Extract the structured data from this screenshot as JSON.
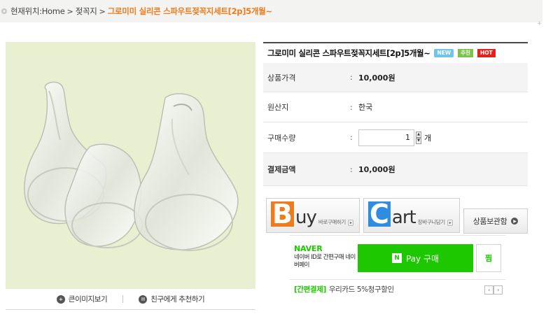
{
  "breadcrumb": {
    "label": "현재위치",
    "colon": " : ",
    "home": "Home",
    "category": "젖꼭지",
    "current": "그로미미 실리콘 스파우트젖꼭지세트[2p]5개월~",
    "separator": ">"
  },
  "image_actions": {
    "zoom_label": "큰이미지보기",
    "recommend_label": "친구에게 추천하기"
  },
  "product": {
    "title": "그로미미 실리콘 스파우트젖꼭지세트[2p]5개월~",
    "badges": {
      "new": "NEW",
      "recommend": "추천",
      "hot": "HOT"
    },
    "colon": ":",
    "price_label": "상품가격",
    "price_value": "10,000원",
    "origin_label": "원산지",
    "origin_value": "한국",
    "qty_label": "구매수량",
    "qty_value": "1",
    "qty_unit": "개",
    "total_label": "결제금액",
    "total_value": "10,000원"
  },
  "buttons": {
    "buy_big": "B",
    "buy_rest": "uy",
    "buy_sub": "바로구매하기",
    "cart_big": "C",
    "cart_rest": "art",
    "cart_sub": "장바구니담기",
    "wish": "상품보관함"
  },
  "naver_pay": {
    "logo": "NAVER",
    "desc": "네이버 ID로 간편구매 네이버페이",
    "pay_icon": "N",
    "pay_label": "Pay 구매",
    "zzim_label": "찜",
    "promo_tag": "[간편결제]",
    "promo_text": "우리카드 5%청구할인",
    "prev": "‹",
    "next": "›"
  },
  "colors": {
    "accent_orange": "#f07b1d",
    "naver_green": "#1ec800",
    "image_bg": "#e9f0d2"
  }
}
